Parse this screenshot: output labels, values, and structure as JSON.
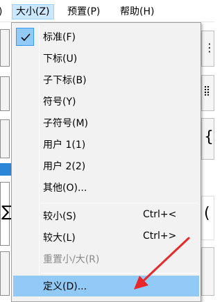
{
  "menubar": {
    "partial": ")",
    "size": "大小(Z)",
    "preset": "预置(P)",
    "help": "帮助(H)"
  },
  "menu": {
    "items": [
      {
        "label": "标准(F)",
        "checked": true
      },
      {
        "label": "下标(U)"
      },
      {
        "label": "子下标(B)"
      },
      {
        "label": "符号(Y)"
      },
      {
        "label": "子符号(M)"
      },
      {
        "label": "用户 1(1)"
      },
      {
        "label": "用户 2(2)"
      },
      {
        "label": "其他(O)..."
      },
      {
        "label": "较小(S)",
        "shortcut": "Ctrl+<"
      },
      {
        "label": "较大(L)",
        "shortcut": "Ctrl+>"
      },
      {
        "label": "重置小/大(R)",
        "disabled": true
      },
      {
        "label": "定义(D)...",
        "highlighted": true
      }
    ]
  },
  "colors": {
    "highlight": "#91c9f7",
    "arrow": "#e8282b",
    "menubar_active": "#cce8ff"
  },
  "annotation": {
    "type": "arrow",
    "color": "red"
  }
}
